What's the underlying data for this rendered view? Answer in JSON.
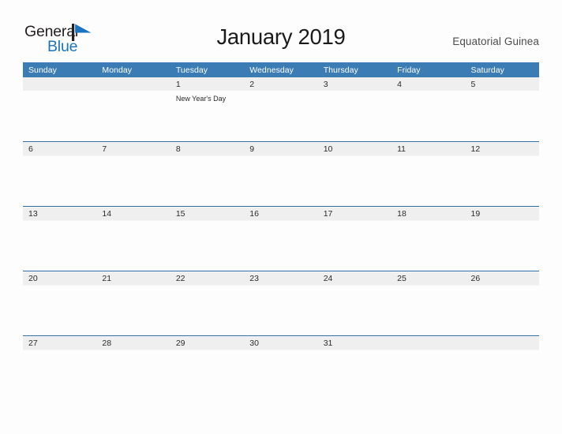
{
  "brand": {
    "name_part1": "General",
    "name_part2": "Blue",
    "flag_icon": "blue-flag-triangle-icon",
    "accent_color": "#1a74c0"
  },
  "header": {
    "title": "January 2019",
    "region": "Equatorial Guinea"
  },
  "theme": {
    "header_blue": "#3b7cb5",
    "row_border_blue": "#2f6fa8",
    "date_band_gray": "#efefef",
    "page_background": "#fdfdfd",
    "text_color": "#2b2b2b"
  },
  "calendar": {
    "month": "January",
    "year": "2019",
    "weekday_headers": [
      "Sunday",
      "Monday",
      "Tuesday",
      "Wednesday",
      "Thursday",
      "Friday",
      "Saturday"
    ],
    "weeks": [
      [
        {
          "day": "",
          "event": ""
        },
        {
          "day": "",
          "event": ""
        },
        {
          "day": "1",
          "event": "New Year's Day"
        },
        {
          "day": "2",
          "event": ""
        },
        {
          "day": "3",
          "event": ""
        },
        {
          "day": "4",
          "event": ""
        },
        {
          "day": "5",
          "event": ""
        }
      ],
      [
        {
          "day": "6",
          "event": ""
        },
        {
          "day": "7",
          "event": ""
        },
        {
          "day": "8",
          "event": ""
        },
        {
          "day": "9",
          "event": ""
        },
        {
          "day": "10",
          "event": ""
        },
        {
          "day": "11",
          "event": ""
        },
        {
          "day": "12",
          "event": ""
        }
      ],
      [
        {
          "day": "13",
          "event": ""
        },
        {
          "day": "14",
          "event": ""
        },
        {
          "day": "15",
          "event": ""
        },
        {
          "day": "16",
          "event": ""
        },
        {
          "day": "17",
          "event": ""
        },
        {
          "day": "18",
          "event": ""
        },
        {
          "day": "19",
          "event": ""
        }
      ],
      [
        {
          "day": "20",
          "event": ""
        },
        {
          "day": "21",
          "event": ""
        },
        {
          "day": "22",
          "event": ""
        },
        {
          "day": "23",
          "event": ""
        },
        {
          "day": "24",
          "event": ""
        },
        {
          "day": "25",
          "event": ""
        },
        {
          "day": "26",
          "event": ""
        }
      ],
      [
        {
          "day": "27",
          "event": ""
        },
        {
          "day": "28",
          "event": ""
        },
        {
          "day": "29",
          "event": ""
        },
        {
          "day": "30",
          "event": ""
        },
        {
          "day": "31",
          "event": ""
        },
        {
          "day": "",
          "event": ""
        },
        {
          "day": "",
          "event": ""
        }
      ]
    ]
  }
}
